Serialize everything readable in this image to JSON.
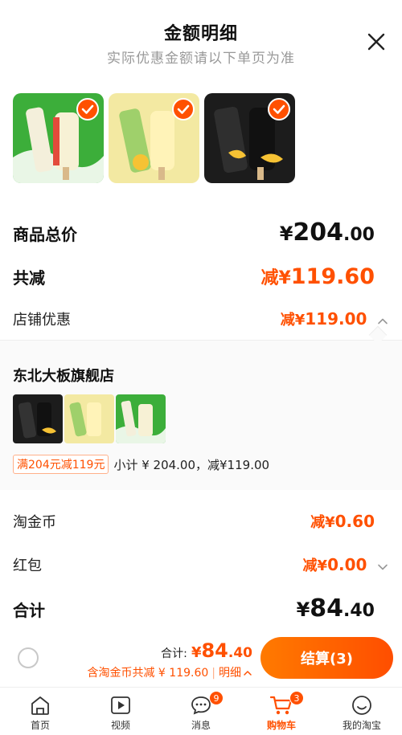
{
  "header": {
    "title": "金额明细",
    "subtitle": "实际优惠金额请以下单页为准",
    "close_icon": "close-icon"
  },
  "products": [
    {
      "theme": "green",
      "checked": true
    },
    {
      "theme": "yellow",
      "checked": true
    },
    {
      "theme": "black",
      "checked": true
    }
  ],
  "summary": {
    "goods_total_label": "商品总价",
    "goods_total_symbol": "¥",
    "goods_total_int": "204",
    "goods_total_dec": ".00",
    "discount_label": "共减",
    "discount_prefix": "减¥",
    "discount_value": "119.60",
    "shop_discount_label": "店铺优惠",
    "shop_discount_prefix": "减¥",
    "shop_discount_value": "119.00"
  },
  "store": {
    "name": "东北大板旗舰店",
    "thumbs": [
      "black",
      "yellow",
      "green"
    ],
    "promo_tag": "满204元减119元",
    "promo_subtotal": "小计 ¥ 204.00，减¥119.00"
  },
  "extras": {
    "coin_label": "淘金币",
    "coin_prefix": "减¥",
    "coin_value": "0.60",
    "redpacket_label": "红包",
    "redpacket_prefix": "减¥",
    "redpacket_value": "0.00",
    "total_label": "合计",
    "total_symbol": "¥",
    "total_int": "84",
    "total_dec": ".40"
  },
  "checkout": {
    "sum_label": "合计:",
    "sum_symbol": "¥",
    "sum_int": "84",
    "sum_dec": ".40",
    "coin_note": "含淘金币共减 ¥ 119.60",
    "sep": "|",
    "detail_label": "明细",
    "settle_label": "结算(3)"
  },
  "tabbar": [
    {
      "label": "首页",
      "icon": "home-icon",
      "badge": ""
    },
    {
      "label": "视频",
      "icon": "video-icon",
      "badge": ""
    },
    {
      "label": "消息",
      "icon": "message-icon",
      "badge": "9"
    },
    {
      "label": "购物车",
      "icon": "cart-icon",
      "badge": "3",
      "active": true
    },
    {
      "label": "我的淘宝",
      "icon": "profile-icon",
      "badge": ""
    }
  ],
  "colors": {
    "accent": "#ff5000",
    "muted": "#999999",
    "panel": "#fafafa"
  }
}
